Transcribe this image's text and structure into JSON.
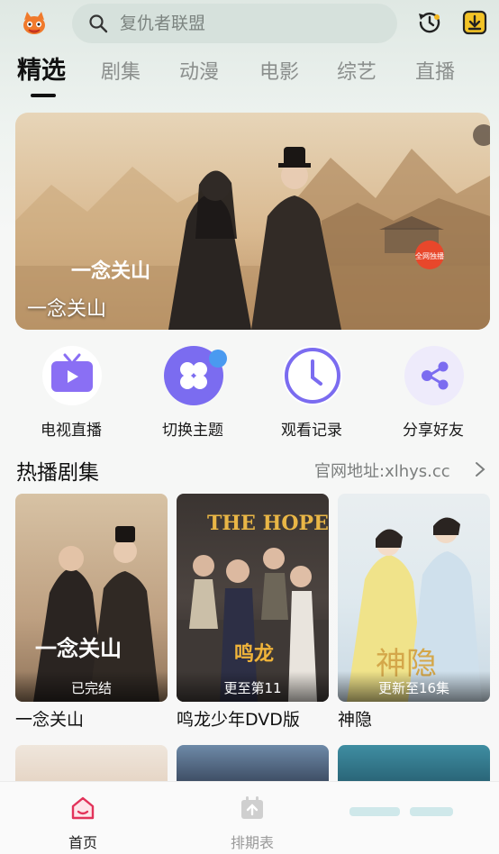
{
  "search": {
    "placeholder": "复仇者联盟"
  },
  "tabs": [
    {
      "label": "精选",
      "active": true
    },
    {
      "label": "剧集"
    },
    {
      "label": "动漫"
    },
    {
      "label": "电影"
    },
    {
      "label": "综艺"
    },
    {
      "label": "直播"
    }
  ],
  "banner": {
    "title": "一念关山",
    "logo_text": "一念关山",
    "stamp_text": "全网独播"
  },
  "quick_actions": [
    {
      "label": "电视直播",
      "icon": "tv-icon"
    },
    {
      "label": "切换主题",
      "icon": "theme-icon"
    },
    {
      "label": "观看记录",
      "icon": "clock-icon"
    },
    {
      "label": "分享好友",
      "icon": "share-icon"
    }
  ],
  "section": {
    "title": "热播剧集",
    "link": "官网地址:xlhys.cc"
  },
  "cards": [
    {
      "title": "一念关山",
      "badge": "已完结",
      "poster_text": "一念关山"
    },
    {
      "title": "鸣龙少年DVD版",
      "badge": "更至第11",
      "poster_text": "THE HOPE"
    },
    {
      "title": "神隐",
      "badge": "更新至16集",
      "poster_text": "神隐"
    }
  ],
  "bottom_nav": [
    {
      "label": "首页",
      "active": true
    },
    {
      "label": "排期表"
    }
  ],
  "colors": {
    "accent_purple": "#7b6cf0",
    "search_bg": "#d6e1dc",
    "active_nav": "#e2335a"
  }
}
